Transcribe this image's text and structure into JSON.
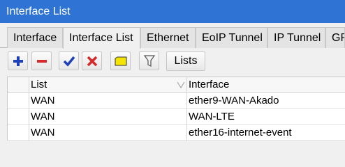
{
  "window": {
    "title": "Interface List"
  },
  "tabs": [
    {
      "label": "Interface",
      "active": false
    },
    {
      "label": "Interface List",
      "active": true
    },
    {
      "label": "Ethernet",
      "active": false
    },
    {
      "label": "EoIP Tunnel",
      "active": false
    },
    {
      "label": "IP Tunnel",
      "active": false
    },
    {
      "label": "GR",
      "active": false
    }
  ],
  "toolbar": {
    "buttons": [
      {
        "icon": "plus-icon",
        "color": "#1f3fb8"
      },
      {
        "icon": "minus-icon",
        "color": "#d62a2a"
      },
      {
        "icon": "check-icon",
        "color": "#1f3fb8"
      },
      {
        "icon": "x-icon",
        "color": "#d62a2a"
      },
      {
        "icon": "note-icon",
        "color": "#f5e400"
      },
      {
        "icon": "filter-icon",
        "color": "#555555"
      }
    ],
    "lists_label": "Lists"
  },
  "table": {
    "columns": [
      "List",
      "Interface"
    ],
    "rows": [
      {
        "list": "WAN",
        "interface": "ether9-WAN-Akado"
      },
      {
        "list": "WAN",
        "interface": "WAN-LTE"
      },
      {
        "list": "WAN",
        "interface": "ether16-internet-event"
      }
    ]
  },
  "colors": {
    "title_bar": "#2f74d4"
  }
}
